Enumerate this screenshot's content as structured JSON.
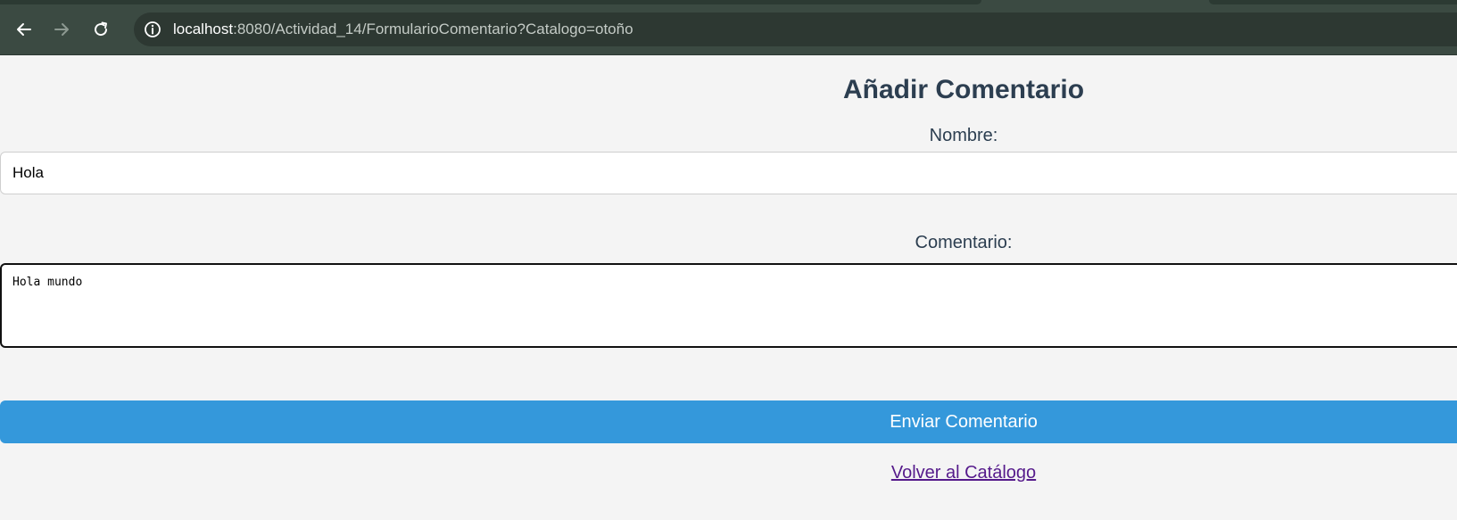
{
  "browser": {
    "url_host": "localhost",
    "url_rest": ":8080/Actividad_14/FormularioComentario?Catalogo=otoño",
    "icons": {
      "back": "arrow-left-icon",
      "forward": "arrow-right-icon",
      "reload": "reload-icon",
      "site_info": "info-icon"
    },
    "colors": {
      "chrome": "#3b4a42",
      "omnibox": "#2d3832"
    }
  },
  "page": {
    "title": "Añadir Comentario",
    "form": {
      "name_label": "Nombre:",
      "name_value": "Hola",
      "comment_label": "Comentario:",
      "comment_value": "Hola mundo",
      "submit_label": "Enviar Comentario"
    },
    "back_link": "Volver al Catálogo",
    "colors": {
      "accent": "#3498db",
      "heading": "#2c3e50",
      "visited_link": "#551a8b"
    }
  }
}
